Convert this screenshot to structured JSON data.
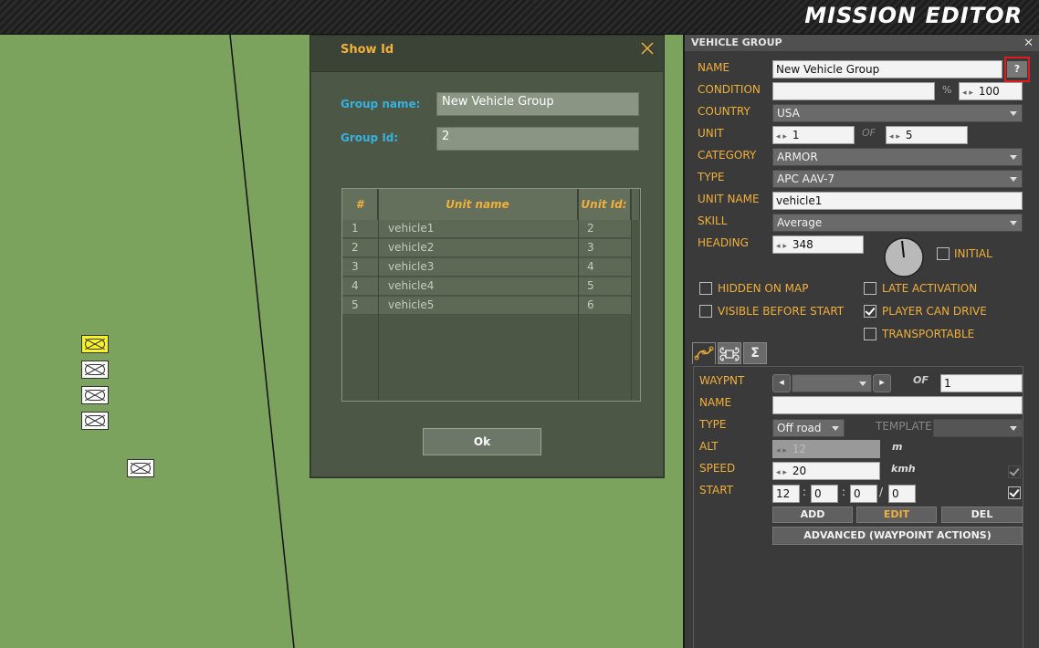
{
  "app": {
    "title": "MISSION EDITOR"
  },
  "dialog": {
    "title": "Show Id",
    "group_name_label": "Group name:",
    "group_name_value": "New Vehicle Group",
    "group_id_label": "Group Id:",
    "group_id_value": "2",
    "table": {
      "headers": [
        "#",
        "Unit name",
        "Unit Id:"
      ],
      "rows": [
        [
          "1",
          "vehicle1",
          "2"
        ],
        [
          "2",
          "vehicle2",
          "3"
        ],
        [
          "3",
          "vehicle3",
          "4"
        ],
        [
          "4",
          "vehicle4",
          "5"
        ],
        [
          "5",
          "vehicle5",
          "6"
        ]
      ]
    },
    "ok_label": "Ok"
  },
  "panel": {
    "title": "VEHICLE GROUP",
    "close": "✕",
    "help": "?",
    "labels": {
      "name": "NAME",
      "condition": "CONDITION",
      "country": "COUNTRY",
      "unit": "UNIT",
      "category": "CATEGORY",
      "type": "TYPE",
      "unit_name": "UNIT NAME",
      "skill": "SKILL",
      "heading": "HEADING"
    },
    "values": {
      "name": "New Vehicle Group",
      "condition": "",
      "percent_sign": "%",
      "condition_pct": "100",
      "country": "USA",
      "unit": "1",
      "of": "OF",
      "unit_total": "5",
      "category": "ARMOR",
      "type": "APC AAV-7",
      "unit_name": "vehicle1",
      "skill": "Average",
      "heading": "348"
    },
    "checks": {
      "initial": "INITIAL",
      "hidden_on_map": "HIDDEN ON MAP",
      "visible_before_start": "VISIBLE BEFORE START",
      "late_activation": "LATE ACTIVATION",
      "player_can_drive": "PLAYER CAN DRIVE",
      "transportable": "TRANSPORTABLE"
    },
    "tabs": {
      "route": "route-icon",
      "triggers": "command-icon",
      "summary": "Σ"
    },
    "waypoint": {
      "labels": {
        "waypnt": "WAYPNT",
        "of": "OF",
        "name": "NAME",
        "type": "TYPE",
        "template": "TEMPLATE",
        "alt": "ALT",
        "speed": "SPEED",
        "start": "START"
      },
      "values": {
        "waypnt_total": "1",
        "name": "",
        "type": "Off road",
        "alt": "12",
        "alt_unit": "m",
        "speed": "20",
        "speed_unit": "kmh",
        "start_h": "12",
        "start_m": "0",
        "start_s": "0",
        "start_d": "0",
        "sep_colon": ":",
        "sep_slash": "/"
      },
      "buttons": {
        "add": "ADD",
        "edit": "EDIT",
        "del": "DEL",
        "advanced": "ADVANCED (WAYPOINT ACTIONS)"
      }
    }
  },
  "colors": {
    "accent": "#f0b03a",
    "dialog_label": "#36b1e0",
    "map": "#7ba35d",
    "highlight": "#e01b1b"
  }
}
